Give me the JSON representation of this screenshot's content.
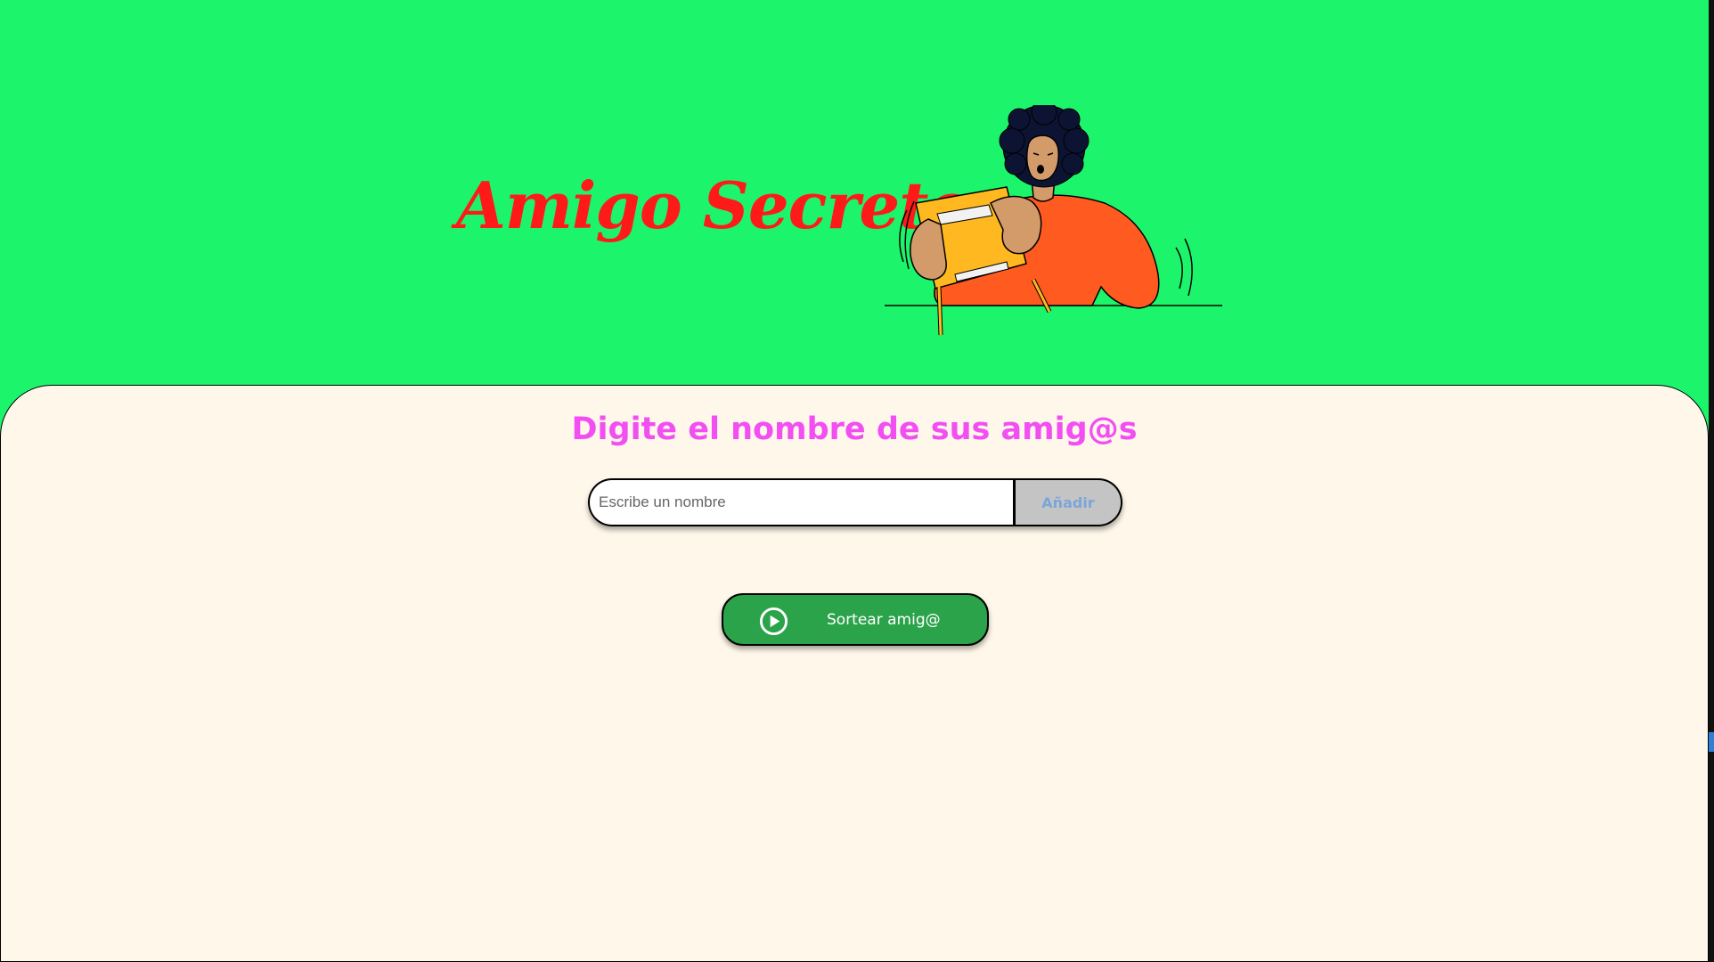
{
  "header": {
    "title": "Amigo Secreto",
    "illustration_icon": "person-opening-gift-illustration"
  },
  "main": {
    "subtitle": "Digite el nombre de sus amig@s",
    "name_input": {
      "placeholder": "Escribe un nombre",
      "value": ""
    },
    "add_button_label": "Añadir",
    "draw_button": {
      "label": "Sortear amig@",
      "icon": "play-circle-icon"
    }
  },
  "colors": {
    "header_bg": "#1cf56b",
    "title": "#ff1a1a",
    "card_bg": "#fff7ea",
    "subtitle": "#f24ff2",
    "add_button_bg": "#c4c4c4",
    "add_button_text": "#7ba6d9",
    "draw_button_bg": "#2ba34a"
  }
}
